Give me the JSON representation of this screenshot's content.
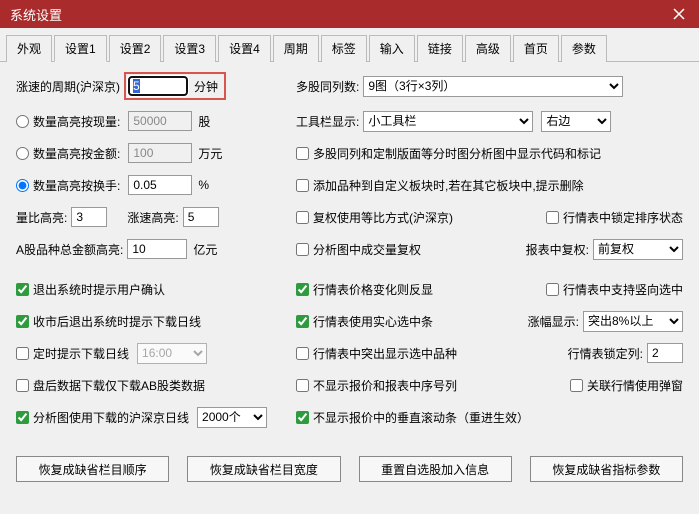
{
  "window": {
    "title": "系统设置"
  },
  "tabs": [
    "外观",
    "设置1",
    "设置2",
    "设置3",
    "设置4",
    "周期",
    "标签",
    "输入",
    "链接",
    "高级",
    "首页",
    "参数"
  ],
  "active_tab": 1,
  "left": {
    "speed_period_label": "涨速的周期(沪深京)",
    "speed_period_value": "5",
    "speed_period_unit": "分钟",
    "r1_label": "数量高亮按现量:",
    "r1_value": "50000",
    "r1_unit": "股",
    "r2_label": "数量高亮按金额:",
    "r2_value": "100",
    "r2_unit": "万元",
    "r3_label": "数量高亮按换手:",
    "r3_value": "0.05",
    "r3_unit": "%",
    "lb_label": "量比高亮:",
    "lb_value": "3",
    "zs_label": "涨速高亮:",
    "zs_value": "5",
    "ag_label": "A股品种总金额高亮:",
    "ag_value": "10",
    "ag_unit": "亿元",
    "c1": "退出系统时提示用户确认",
    "c2": "收市后退出系统时提示下载日线",
    "c3": "定时提示下载日线",
    "c3_time": "16:00",
    "c4": "盘后数据下载仅下载AB股类数据",
    "c5": "分析图使用下载的沪深京日线",
    "c5_value": "2000个"
  },
  "right": {
    "dg_label": "多股同列数:",
    "dg_value": "9图（3行×3列）",
    "tb_label": "工具栏显示:",
    "tb_show": "小工具栏",
    "tb_pos": "右边",
    "c_dg": "多股同列和定制版面等分时图分析图中显示代码和标记",
    "c_add": "添加品种到自定义板块时,若在其它板块中,提示删除",
    "c_fq": "复权使用等比方式(沪深京)",
    "c_lock": "行情表中锁定排序状态",
    "c_vol": "分析图中成交量复权",
    "fq_label": "报表中复权:",
    "fq_value": "前复权",
    "c_price": "行情表价格变化则反显",
    "c_vert": "行情表中支持竖向选中",
    "c_solid": "行情表使用实心选中条",
    "zf_label": "涨幅显示:",
    "zf_value": "突出8%以上",
    "c_highlight": "行情表中突出显示选中品种",
    "lock_label": "行情表锁定列:",
    "lock_value": "2",
    "c_noseq": "不显示报价和报表中序号列",
    "c_assoc": "关联行情使用弹窗",
    "c_noscroll": "不显示报价中的垂直滚动条（重进生效）"
  },
  "buttons": {
    "b1": "恢复成缺省栏目顺序",
    "b2": "恢复成缺省栏目宽度",
    "b3": "重置自选股加入信息",
    "b4": "恢复成缺省指标参数"
  }
}
